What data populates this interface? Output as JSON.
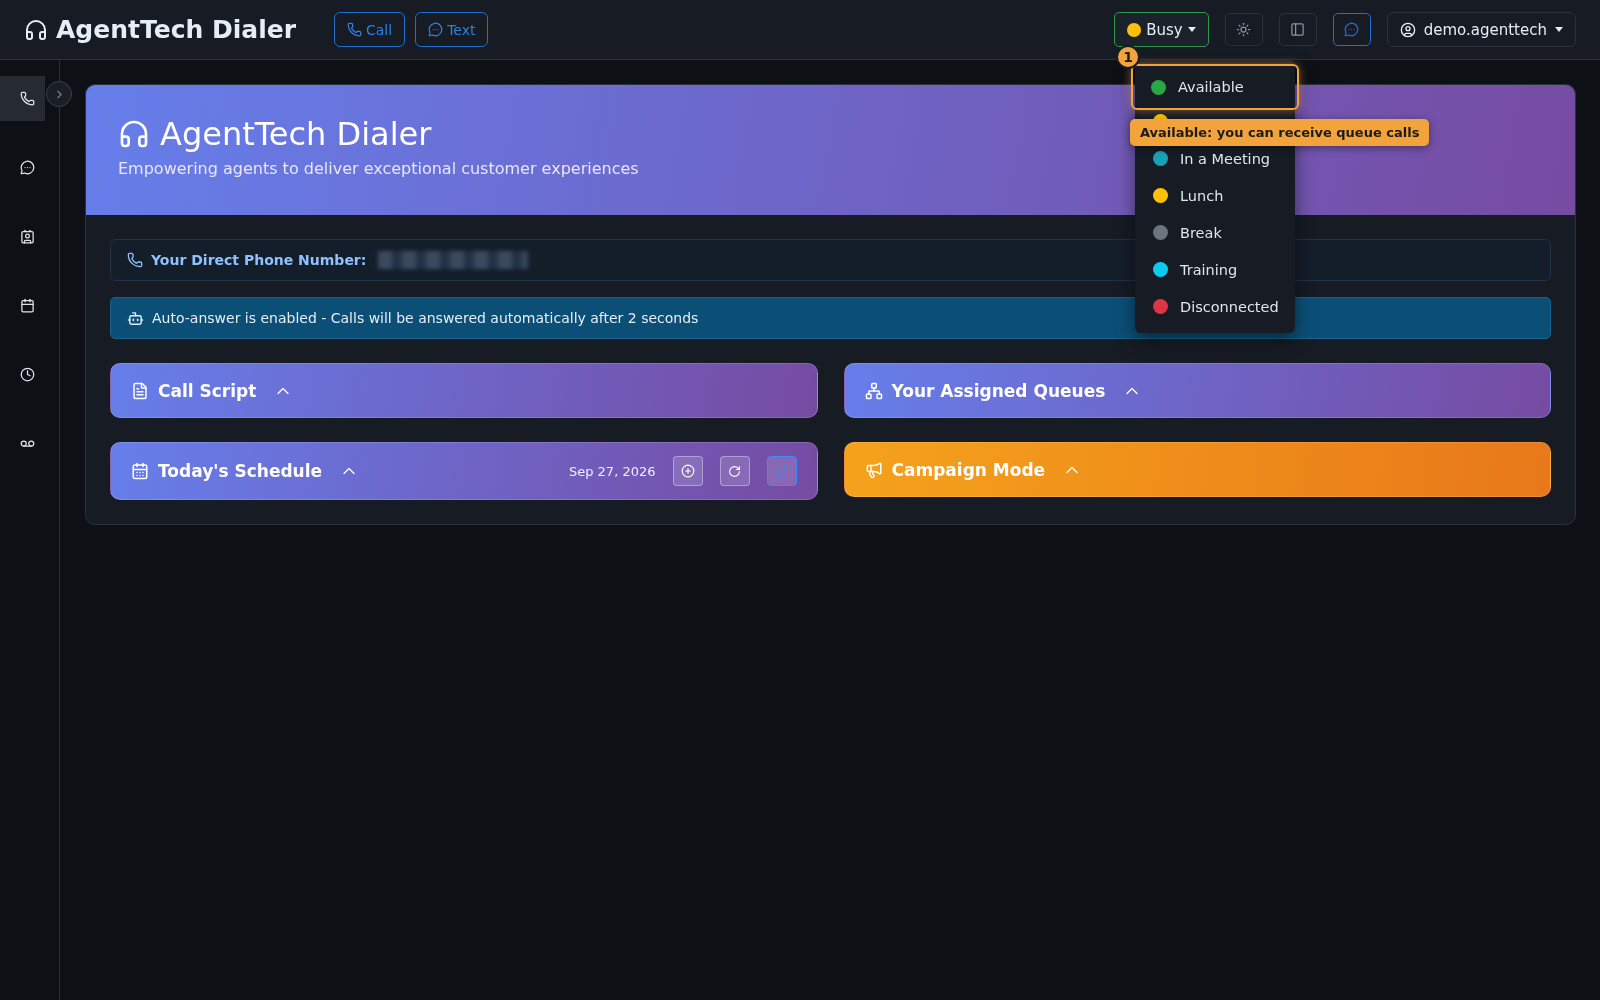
{
  "header": {
    "brand": "AgentTech Dialer",
    "actions": [
      {
        "kind": "call",
        "label": "Call"
      },
      {
        "kind": "text",
        "label": "Text"
      }
    ],
    "status": {
      "label": "Busy",
      "color": "#ffc107"
    },
    "toolbar": [
      {
        "kind": "theme",
        "selected": false
      },
      {
        "kind": "panel",
        "selected": false
      },
      {
        "kind": "chat",
        "selected": true
      }
    ],
    "user": "demo.agenttech"
  },
  "sidebar": {
    "items": [
      {
        "kind": "phone",
        "selected": true
      },
      {
        "kind": "chat",
        "selected": false
      },
      {
        "kind": "contacts",
        "selected": false
      },
      {
        "kind": "calendar",
        "selected": false
      },
      {
        "kind": "history",
        "selected": false
      },
      {
        "kind": "voicemail",
        "selected": false
      }
    ]
  },
  "hero": {
    "title": "AgentTech Dialer",
    "subtitle": "Empowering agents to deliver exceptional customer experiences"
  },
  "phone_notice": {
    "label": "Your Direct Phone Number:"
  },
  "auto_answer": "Auto-answer is enabled - Calls will be answered automatically after 2 seconds",
  "panels": [
    {
      "kind": "script",
      "title": "Call Script",
      "expanded": true
    },
    {
      "kind": "queues",
      "title": "Your Assigned Queues",
      "expanded": true
    },
    {
      "kind": "schedule",
      "title": "Today's Schedule",
      "expanded": true,
      "date": "Sep 27, 2026"
    },
    {
      "kind": "campaign",
      "title": "Campaign Mode",
      "expanded": true
    }
  ],
  "status_menu": {
    "items": [
      {
        "label": "Available",
        "color": "#28a745",
        "selected": true
      },
      {
        "color": "#ffc107",
        "selected": false
      },
      {
        "label": "In a Meeting",
        "color": "#17a2b8",
        "selected": false
      },
      {
        "label": "Lunch",
        "color": "#ffc107",
        "selected": false
      },
      {
        "label": "Break",
        "color": "#6c757d",
        "selected": false
      },
      {
        "label": "Training",
        "color": "#0dcaf0",
        "selected": false
      },
      {
        "label": "Disconnected",
        "color": "#dc3545",
        "selected": false
      }
    ]
  },
  "tour": {
    "step": "1",
    "tip": "Available: you can receive queue calls"
  }
}
